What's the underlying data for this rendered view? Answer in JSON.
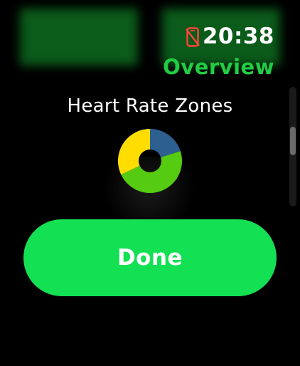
{
  "status": {
    "time": "20:38",
    "phone_icon": "phone-disconnected-icon",
    "phone_icon_color": "#ff453a"
  },
  "nav": {
    "title": "Overview",
    "title_color": "#22cc44"
  },
  "section": {
    "title": "Heart Rate Zones"
  },
  "heart_rate_zones": {
    "segments": [
      {
        "fraction": 0.2,
        "color": "#2d5f8f"
      },
      {
        "fraction": 0.48,
        "color": "#55cc11"
      },
      {
        "fraction": 0.32,
        "color": "#ffdd00"
      }
    ]
  },
  "actions": {
    "done_label": "Done",
    "done_color": "#14e054"
  }
}
